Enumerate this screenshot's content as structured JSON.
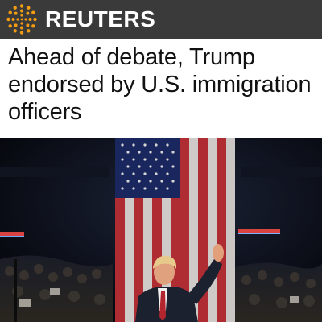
{
  "header": {
    "brand": "REUTERS",
    "logo_icon": "reuters-dot-sphere-icon",
    "background": "#3a3a3a",
    "accent": "#f39c12"
  },
  "article": {
    "headline": "Ahead of debate, Trump endorsed by U.S. immigration officers",
    "photo_description_icon": "rally-photo"
  }
}
